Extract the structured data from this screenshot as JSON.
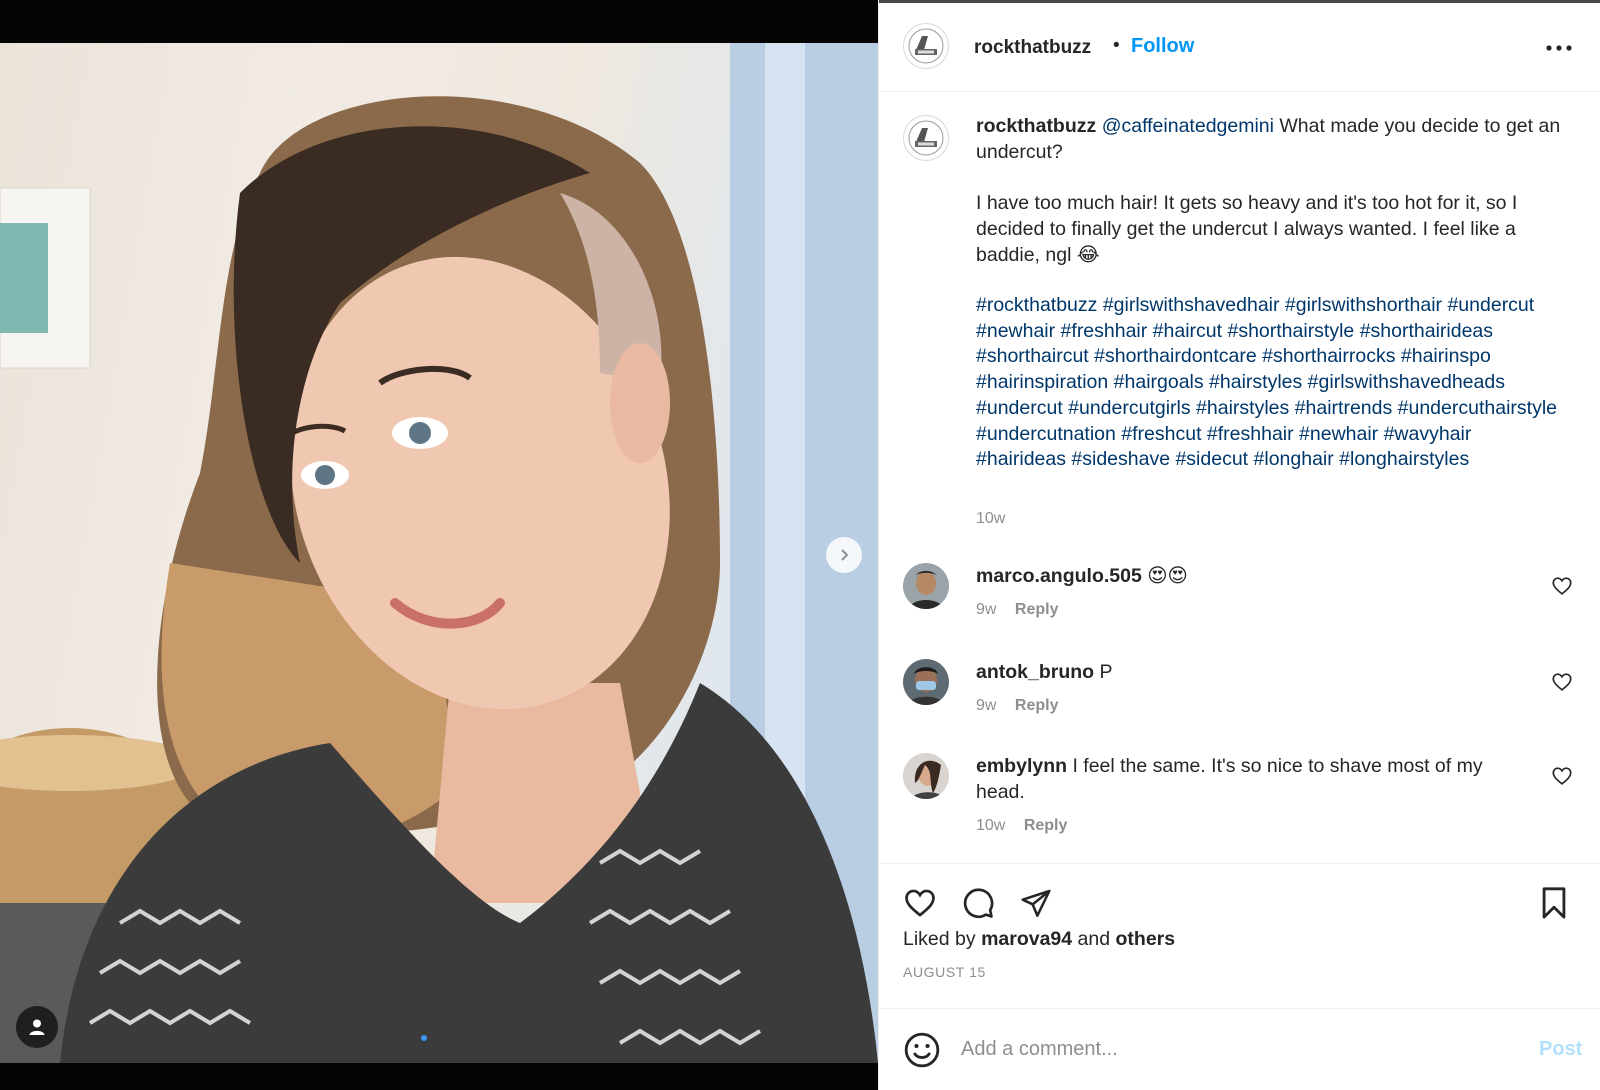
{
  "post": {
    "username": "rockthatbuzz",
    "separator": "•",
    "follow_label": "Follow",
    "more_icon": "more-horizontal-icon"
  },
  "caption": {
    "username": "rockthatbuzz",
    "mention": "@caffeinatedgemini",
    "question": " What made you decide to get an undercut?",
    "answer": "I have too much hair! It gets so heavy and it's too hot for it, so I decided to finally get the undercut I always wanted. I feel like a baddie, ngl 😂",
    "hashtags": "#rockthatbuzz #girlswithshavedhair #girlswithshorthair #undercut #newhair #freshhair #haircut #shorthairstyle #shorthairideas #shorthaircut #shorthairdontcare #shorthairrocks #hairinspo #hairinspiration #hairgoals #hairstyles #girlswithshavedheads #undercut #undercutgirls #hairstyles #hairtrends #undercuthairstyle #undercutnation #freshcut #freshhair #newhair #wavyhair #hairideas #sideshave #sidecut #longhair #longhairstyles",
    "time": "10w"
  },
  "comments": [
    {
      "username": "marco.angulo.505",
      "text": " 😍😍",
      "time": "9w",
      "reply_label": "Reply"
    },
    {
      "username": "antok_bruno",
      "text": " P",
      "time": "9w",
      "reply_label": "Reply"
    },
    {
      "username": "embylynn",
      "text": " I feel the same. It's so nice to shave most of my head.",
      "time": "10w",
      "reply_label": "Reply"
    }
  ],
  "actions": {
    "liked_by_prefix": "Liked by ",
    "liked_by_user": "marova94",
    "liked_by_and": " and ",
    "liked_by_others": "others",
    "date": "AUGUST 15"
  },
  "add_comment": {
    "placeholder": "Add a comment...",
    "post_label": "Post"
  },
  "colors": {
    "accent": "#0095f6",
    "link": "#00376b",
    "muted": "#8e8e8e",
    "post_disabled": "#b2dffc"
  }
}
